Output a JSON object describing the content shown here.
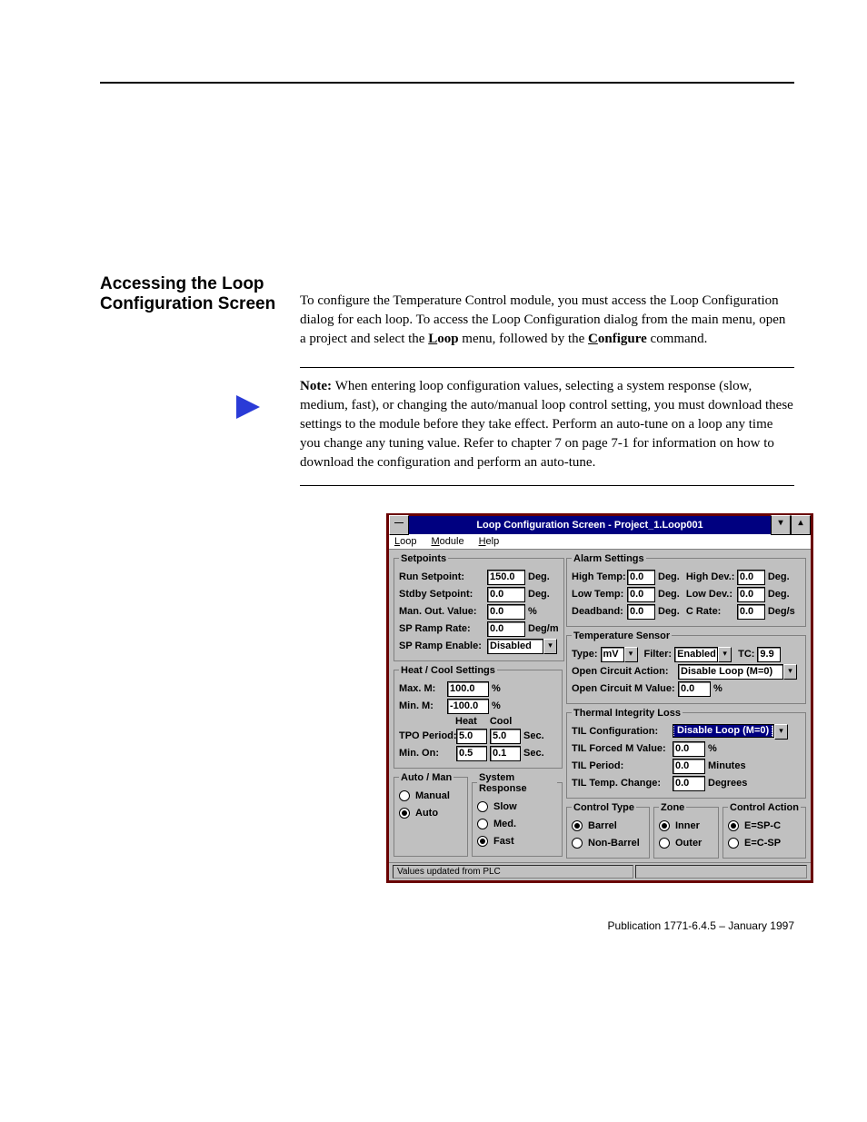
{
  "doc": {
    "section_title_l1": "Accessing the Loop",
    "section_title_l2": "Configuration Screen",
    "para": "To configure the Temperature Control module, you must access the Loop Configuration dialog for each loop. To access the Loop Configuration dialog from the main menu, open a project and select the ",
    "menu1": "Loop",
    "para2": " menu, followed by the ",
    "menu2": "Configure",
    "para3": " command.",
    "tip_lead": "Note: ",
    "tip_body": "When entering loop configuration values, selecting a system response (slow, medium, fast), or changing the auto/manual loop control setting, you must download these settings to the module before they take effect. Perform an auto-tune on a loop any time you change any tuning value. Refer to chapter 7 on page 7-1 for information on how to download the configuration and perform an auto-tune.",
    "pub": "Publication 1771-6.4.5 – January 1997"
  },
  "win": {
    "title": "Loop Configuration Screen - Project_1.Loop001",
    "menu": {
      "loop": "Loop",
      "module": "Module",
      "help": "Help"
    },
    "status": "Values updated from PLC"
  },
  "setpoints": {
    "legend": "Setpoints",
    "run_l": "Run Setpoint:",
    "run_v": "150.0",
    "run_u": "Deg.",
    "stdby_l": "Stdby Setpoint:",
    "stdby_v": "0.0",
    "stdby_u": "Deg.",
    "man_l": "Man. Out. Value:",
    "man_v": "0.0",
    "man_u": "%",
    "ramp_l": "SP Ramp Rate:",
    "ramp_v": "0.0",
    "ramp_u": "Deg/m",
    "rampen_l": "SP Ramp Enable:",
    "rampen_v": "Disabled"
  },
  "heatcool": {
    "legend": "Heat / Cool Settings",
    "max_l": "Max. M:",
    "max_v": "100.0",
    "max_u": "%",
    "min_l": "Min. M:",
    "min_v": "-100.0",
    "min_u": "%",
    "h_head": "Heat",
    "c_head": "Cool",
    "tpo_l": "TPO Period:",
    "tpo_h": "5.0",
    "tpo_c": "5.0",
    "tpo_u": "Sec.",
    "minon_l": "Min. On:",
    "minon_h": "0.5",
    "minon_c": "0.1",
    "minon_u": "Sec."
  },
  "automan": {
    "legend": "Auto / Man",
    "manual": "Manual",
    "auto": "Auto"
  },
  "sysresp": {
    "legend": "System Response",
    "slow": "Slow",
    "med": "Med.",
    "fast": "Fast"
  },
  "alarm": {
    "legend": "Alarm Settings",
    "hi_l": "High Temp:",
    "hi_v": "0.0",
    "hi_u": "Deg.",
    "hidev_l": "High Dev.:",
    "hidev_v": "0.0",
    "hidev_u": "Deg.",
    "lo_l": "Low Temp:",
    "lo_v": "0.0",
    "lo_u": "Deg.",
    "lodev_l": "Low Dev.:",
    "lodev_v": "0.0",
    "lodev_u": "Deg.",
    "db_l": "Deadband:",
    "db_v": "0.0",
    "db_u": "Deg.",
    "cr_l": "C Rate:",
    "cr_v": "0.0",
    "cr_u": "Deg/s"
  },
  "sensor": {
    "legend": "Temperature Sensor",
    "type_l": "Type:",
    "type_v": "mV",
    "filter_l": "Filter:",
    "filter_v": "Enabled",
    "tc_l": "TC:",
    "tc_v": "9.9",
    "oca_l": "Open Circuit Action:",
    "oca_v": "Disable Loop (M=0)",
    "ocm_l": "Open Circuit M Value:",
    "ocm_v": "0.0",
    "ocm_u": "%"
  },
  "til": {
    "legend": "Thermal Integrity Loss",
    "cfg_l": "TIL Configuration:",
    "cfg_v": "Disable Loop (M=0)",
    "fm_l": "TIL Forced M Value:",
    "fm_v": "0.0",
    "fm_u": "%",
    "per_l": "TIL Period:",
    "per_v": "0.0",
    "per_u": "Minutes",
    "tc_l": "TIL Temp. Change:",
    "tc_v": "0.0",
    "tc_u": "Degrees"
  },
  "ctype": {
    "legend": "Control Type",
    "barrel": "Barrel",
    "nonbarrel": "Non-Barrel"
  },
  "zone": {
    "legend": "Zone",
    "inner": "Inner",
    "outer": "Outer"
  },
  "caction": {
    "legend": "Control Action",
    "a": "E=SP-C",
    "b": "E=C-SP"
  }
}
